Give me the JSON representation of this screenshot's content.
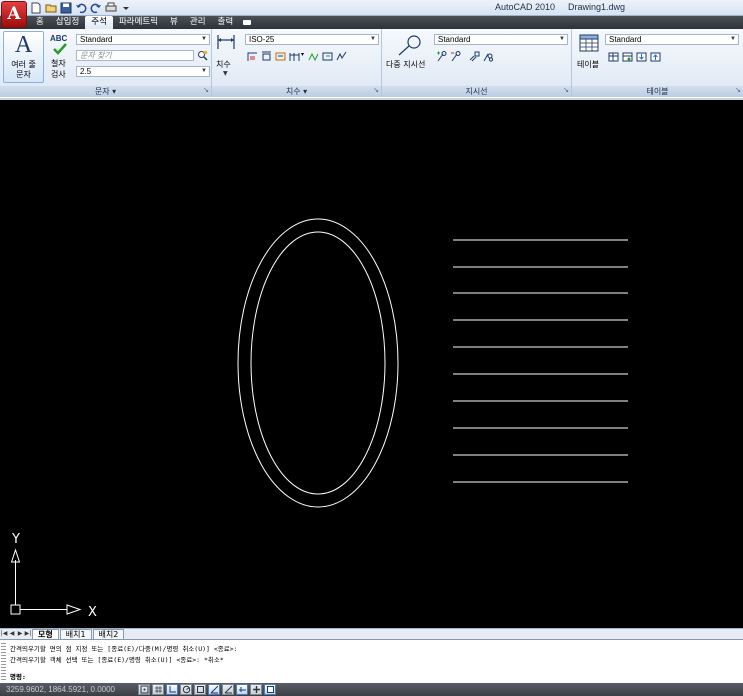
{
  "window": {
    "app_title": "AutoCAD 2010",
    "doc_title": "Drawing1.dwg",
    "app_button_letter": "A"
  },
  "quick_access": [
    "new-icon",
    "open-icon",
    "save-icon",
    "undo-icon",
    "redo-icon",
    "plot-icon",
    "dropdown-icon"
  ],
  "ribbon_tabs": [
    {
      "label": "홈",
      "active": false
    },
    {
      "label": "삽입정",
      "active": false
    },
    {
      "label": "주석",
      "active": true
    },
    {
      "label": "파라메트릭",
      "active": false
    },
    {
      "label": "뷰",
      "active": false
    },
    {
      "label": "관리",
      "active": false
    },
    {
      "label": "출력",
      "active": false
    }
  ],
  "panels": {
    "text": {
      "label": "문자",
      "mtext_line1": "여러 줄",
      "mtext_line2": "문자",
      "spell_abc": "ABC",
      "spell_line1": "철자",
      "spell_line2": "검사",
      "style_value": "Standard",
      "find_placeholder": "문자 찾기",
      "height_value": "2.5"
    },
    "dimension": {
      "label": "치수",
      "button_label": "치수",
      "style_value": "ISO-25"
    },
    "leader": {
      "label": "지시선",
      "button_label": "다중 지시선",
      "style_value": "Standard"
    },
    "table": {
      "label": "테이블",
      "button_label": "테이블",
      "style_value": "Standard"
    }
  },
  "ucs": {
    "x_label": "X",
    "y_label": "Y"
  },
  "layout_tabs": [
    {
      "label": "모형",
      "active": true
    },
    {
      "label": "배치1",
      "active": false
    },
    {
      "label": "배치2",
      "active": false
    }
  ],
  "command_history": [
    "간격띄우기할 면의 점 지정 또는 [종료(E)/다중(M)/명령 취소(U)] <종료>:",
    "간격띄우기할 객체 선택 또는 [종료(E)/명령 취소(U)] <종료>: *취소*"
  ],
  "command_prompt": "명령:",
  "status": {
    "coords": "3259.9602, 1864.5921, 0.0000"
  },
  "colors": {
    "viewport_bg": "#000000",
    "geometry": "#ffffff",
    "ribbon_top": "#f6f9fd",
    "tabbar": "#3a3e45"
  }
}
